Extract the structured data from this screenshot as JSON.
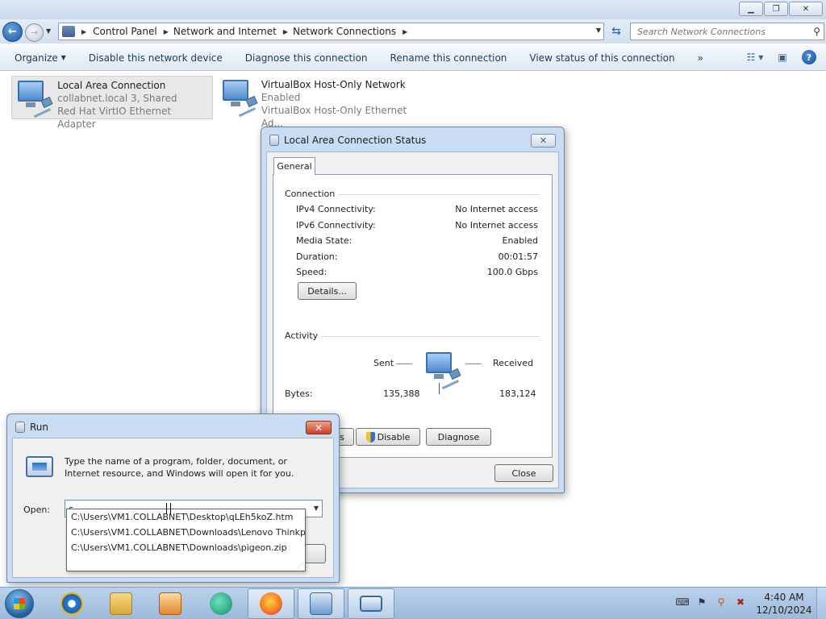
{
  "explorer": {
    "breadcrumb": [
      "Control Panel",
      "Network and Internet",
      "Network Connections"
    ],
    "search_placeholder": "Search Network Connections",
    "toolbar": {
      "organize": "Organize",
      "disable": "Disable this network device",
      "diagnose": "Diagnose this connection",
      "rename": "Rename this connection",
      "view_status": "View status of this connection",
      "more": "»"
    },
    "connections": [
      {
        "name": "Local Area Connection",
        "status": "collabnet.local  3, Shared",
        "adapter": "Red Hat VirtIO Ethernet Adapter"
      },
      {
        "name": "VirtualBox Host-Only Network",
        "status": "Enabled",
        "adapter": "VirtualBox Host-Only Ethernet Ad..."
      }
    ]
  },
  "status_dialog": {
    "title": "Local Area Connection Status",
    "tab": "General",
    "connection_label": "Connection",
    "rows": [
      {
        "label": "IPv4 Connectivity:",
        "value": "No Internet access"
      },
      {
        "label": "IPv6 Connectivity:",
        "value": "No Internet access"
      },
      {
        "label": "Media State:",
        "value": "Enabled"
      },
      {
        "label": "Duration:",
        "value": "00:01:57"
      },
      {
        "label": "Speed:",
        "value": "100.0 Gbps"
      }
    ],
    "details_button": "Details...",
    "activity_label": "Activity",
    "sent_label": "Sent",
    "received_label": "Received",
    "bytes_label": "Bytes:",
    "bytes_sent": "135,388",
    "bytes_received": "183,124",
    "properties_partial": "s",
    "disable_button": "Disable",
    "diagnose_button": "Diagnose",
    "close_button": "Close"
  },
  "run_dialog": {
    "title": "Run",
    "description": "Type the name of a program, folder, document, or Internet resource, and Windows will open it for you.",
    "open_label": "Open:",
    "input_value": "c",
    "autocomplete": [
      "C:\\Users\\VM1.COLLABNET\\Desktop\\qLEh5koZ.htm",
      "C:\\Users\\VM1.COLLABNET\\Downloads\\Lenovo Thinkp",
      "C:\\Users\\VM1.COLLABNET\\Downloads\\pigeon.zip"
    ]
  },
  "taskbar": {
    "time": "4:40 AM",
    "date": "12/10/2024",
    "icons": [
      "internet-explorer-icon",
      "file-explorer-icon",
      "media-player-icon",
      "chat-app-icon",
      "firefox-icon",
      "control-panel-icon",
      "run-icon"
    ]
  },
  "colors": {
    "accent": "#1e395b",
    "title_gradient": "#cddbee",
    "taskbar": "#9cb9da"
  }
}
